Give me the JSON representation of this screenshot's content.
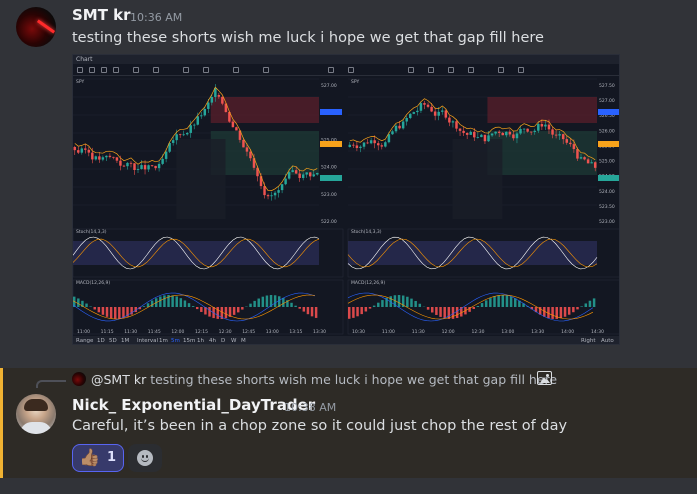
{
  "message1": {
    "username": "SMT kr",
    "timestamp": "10:36 AM",
    "text": "testing these shorts wish me luck i hope we get that gap fill here",
    "attachment": {
      "type": "image",
      "app_label": "Chart",
      "bottom_bar": {
        "range_label": "Range",
        "range_options": [
          "1D",
          "5D",
          "1M",
          "Interval",
          "1m",
          "5m",
          "15m",
          "1h",
          "4h",
          "D",
          "W",
          "M"
        ],
        "right_buttons": [
          "Right",
          "Auto"
        ]
      },
      "left_pane": {
        "symbol": "SPY",
        "price_labels": [
          "527.00",
          "526.00",
          "525.00",
          "524.00",
          "523.00",
          "522.00"
        ],
        "stoch_label": "Stoch(14,3,3)",
        "macd_label": "MACD(12,26,9)",
        "time_labels": [
          "11:00",
          "11:15",
          "11:30",
          "11:45",
          "12:00",
          "12:15",
          "12:30",
          "12:45",
          "13:00",
          "13:15",
          "13:30"
        ]
      },
      "right_pane": {
        "symbol": "SPY",
        "price_labels": [
          "527.50",
          "527.00",
          "526.50",
          "526.00",
          "525.50",
          "525.00",
          "524.50",
          "524.00",
          "523.50",
          "523.00"
        ],
        "stoch_label": "Stoch(14,3,3)",
        "macd_label": "MACD(12,26,9)",
        "time_labels": [
          "10:30",
          "11:00",
          "11:30",
          "12:00",
          "12:30",
          "13:00",
          "13:30",
          "14:00",
          "14:30"
        ]
      }
    }
  },
  "message2": {
    "reply_to": {
      "mention": "@SMT kr",
      "text": "testing these shorts wish me luck i hope we get that gap fill here",
      "icon": "image-icon"
    },
    "username": "Nick_ Exponential_DayTrader",
    "timestamp": "10:38 AM",
    "text": "Careful, it’s been in a chop zone so it could just chop the rest of day",
    "reaction": {
      "emoji": "👍🏽",
      "count": "1"
    },
    "add_reaction_icon": "smiley-add-reaction-icon"
  },
  "colors": {
    "background": "#313338",
    "reply_highlight": "#2e2b26",
    "reply_bar": "#f0b232",
    "reaction_bg": "#373a6b",
    "reaction_border": "#5865f2",
    "chart_bg": "#131722",
    "candle_up": "#26a69a",
    "candle_down": "#ef5350"
  }
}
